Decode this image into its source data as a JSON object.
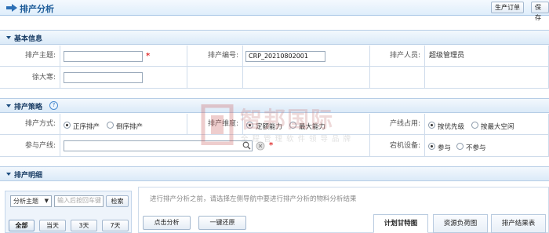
{
  "header": {
    "title": "排产分析",
    "buttons": {
      "production_order": "生产订单",
      "save": "保存"
    }
  },
  "basic_info": {
    "section_label": "基本信息",
    "fields": {
      "topic_label": "排产主题:",
      "topic_value": "",
      "code_label": "排产编号:",
      "code_value": "CRP_20210802001",
      "person_label": "排产人员:",
      "person_value": "超级管理员",
      "xudaji_label": "徐大寒:",
      "xudaji_value": ""
    }
  },
  "strategy": {
    "section_label": "排产策略",
    "help_icon_text": "?",
    "mode_label": "排产方式:",
    "mode_options": [
      "正序排产",
      "倒序排产"
    ],
    "dimension_label": "排产维度:",
    "dimension_options": [
      "定额能力",
      "最大能力"
    ],
    "line_label": "产线占用:",
    "line_options": [
      "按优先级",
      "按最大空闲"
    ],
    "join_line_label": "参与产线:",
    "downtime_label": "宕机设备:",
    "downtime_options": [
      "参与",
      "不参与"
    ]
  },
  "detail": {
    "section_label": "排产明细",
    "analysis_select": "分析主题",
    "search_placeholder": "输入后按回车键",
    "search_button": "检索",
    "range_buttons": [
      "全部",
      "当天",
      "3天",
      "7天"
    ],
    "hint": "进行排产分析之前，请选择左侧导航中要进行排产分析的物料分析结果",
    "action_buttons": {
      "analyze": "点击分析",
      "restore": "一键还原"
    },
    "tabs": [
      "计划甘特图",
      "资源负荷图",
      "排产结果表"
    ]
  },
  "watermark": {
    "title": "智邦国际",
    "subtitle": "全程管理软件领导品牌"
  },
  "colors": {
    "accent": "#1d5c99",
    "required": "#e03030",
    "section_bg": "#dbeaf8"
  }
}
